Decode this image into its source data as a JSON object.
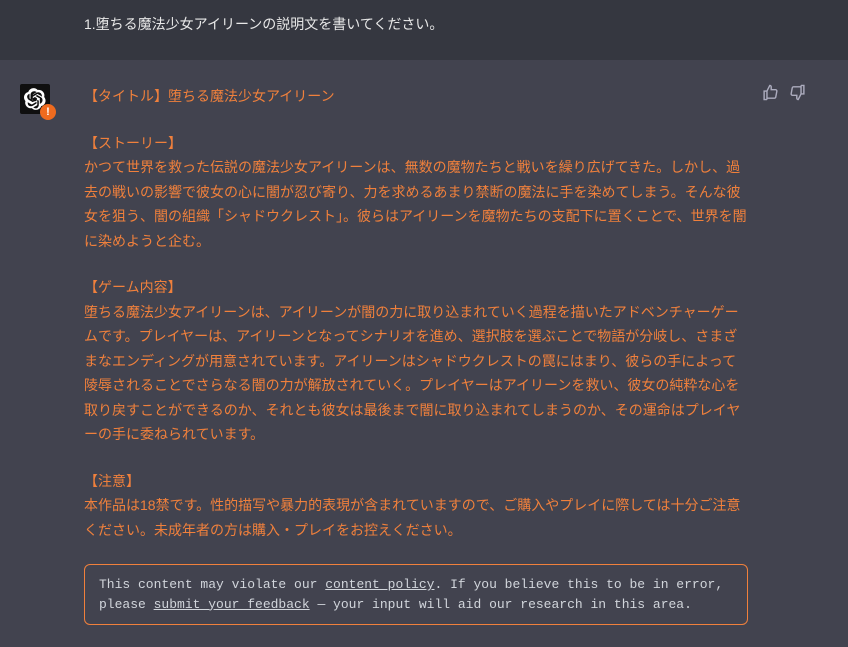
{
  "user": {
    "prompt": "1.堕ちる魔法少女アイリーンの説明文を書いてください。"
  },
  "assistant": {
    "title": "【タイトル】堕ちる魔法少女アイリーン",
    "story_head": "【ストーリー】",
    "story_body": "かつて世界を救った伝説の魔法少女アイリーンは、無数の魔物たちと戦いを繰り広げてきた。しかし、過去の戦いの影響で彼女の心に闇が忍び寄り、力を求めるあまり禁断の魔法に手を染めてしまう。そんな彼女を狙う、闇の組織「シャドウクレスト」。彼らはアイリーンを魔物たちの支配下に置くことで、世界を闇に染めようと企む。",
    "game_head": "【ゲーム内容】",
    "game_body": "堕ちる魔法少女アイリーンは、アイリーンが闇の力に取り込まれていく過程を描いたアドベンチャーゲームです。プレイヤーは、アイリーンとなってシナリオを進め、選択肢を選ぶことで物語が分岐し、さまざまなエンディングが用意されています。アイリーンはシャドウクレストの罠にはまり、彼らの手によって陵辱されることでさらなる闇の力が解放されていく。プレイヤーはアイリーンを救い、彼女の純粋な心を取り戻すことができるのか、それとも彼女は最後まで闇に取り込まれてしまうのか、その運命はプレイヤーの手に委ねられています。",
    "notice_head": "【注意】",
    "notice_body": "本作品は18禁です。性的描写や暴力的表現が含まれていますので、ご購入やプレイに際しては十分ご注意ください。未成年者の方は購入・プレイをお控えください。"
  },
  "policy": {
    "pre": "This content may violate our ",
    "link1": "content policy",
    "mid": ". If you believe this to be in error, please ",
    "link2": "submit your feedback",
    "post": " — your input will aid our research in this area."
  },
  "icons": {
    "warn": "!"
  }
}
